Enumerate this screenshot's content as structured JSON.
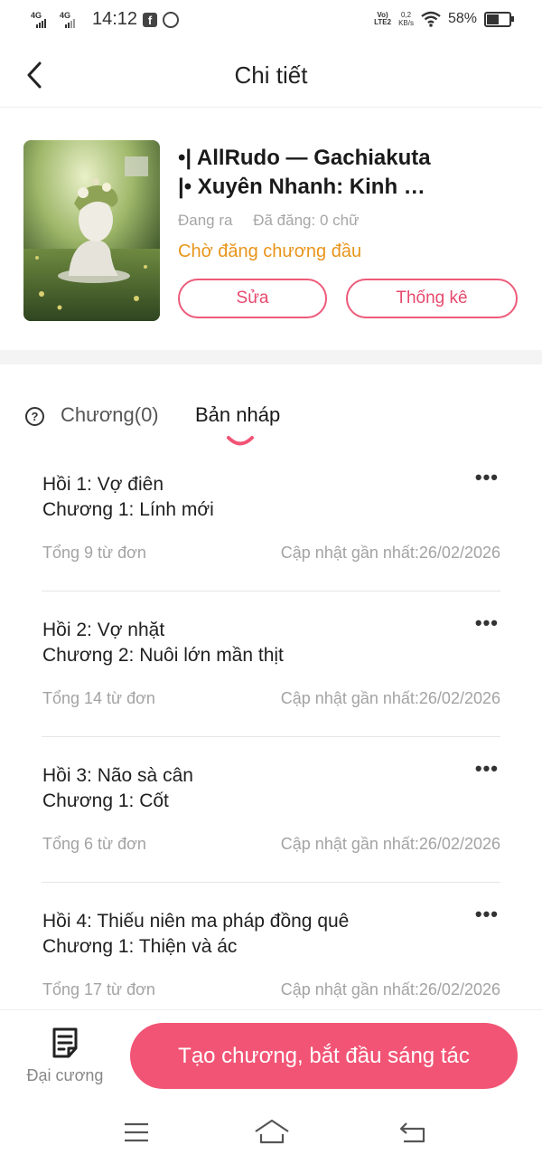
{
  "status_bar": {
    "net1": "4G",
    "net2": "4G",
    "time": "14:12",
    "volte": "VoLTE2",
    "speed_value": "0,2",
    "speed_unit": "KB/s",
    "battery_percent": "58%",
    "battery_level": 0.58
  },
  "header": {
    "title": "Chi tiết"
  },
  "book": {
    "title_line1": "•| AllRudo — Gachiakuta",
    "title_line2": "|• Xuyên Nhanh: Kinh …",
    "status": "Đang ra",
    "posted": "Đã đăng: 0 chữ",
    "publish_state": "Chờ đăng chương đầu",
    "edit_label": "Sửa",
    "stats_label": "Thống kê"
  },
  "tabs": {
    "chapters_label": "Chương(0)",
    "drafts_label": "Bản nháp",
    "active": "drafts"
  },
  "drafts": [
    {
      "arc": "Hồi 1: Vợ điên",
      "chapter": "Chương 1: Lính mới",
      "words": "Tổng 9 từ đơn",
      "updated": "Cập nhật gần nhất:26/02/2026"
    },
    {
      "arc": "Hồi 2: Vợ nhặt",
      "chapter": "Chương 2: Nuôi lớn mần thịt",
      "words": "Tổng 14 từ đơn",
      "updated": "Cập nhật gần nhất:26/02/2026"
    },
    {
      "arc": "Hồi 3: Não sà cân",
      "chapter": "Chương 1: Cốt",
      "words": "Tổng 6 từ đơn",
      "updated": "Cập nhật gần nhất:26/02/2026"
    },
    {
      "arc": "Hồi 4: Thiếu niên ma pháp đồng quê",
      "chapter": "Chương 1: Thiện và ác",
      "words": "Tổng 17 từ đơn",
      "updated": "Cập nhật gần nhất:26/02/2026"
    }
  ],
  "bottom": {
    "outline_label": "Đại cương",
    "create_label": "Tạo chương, bắt đầu sáng tác"
  },
  "colors": {
    "accent": "#f25475",
    "status_orange": "#e8941a"
  }
}
